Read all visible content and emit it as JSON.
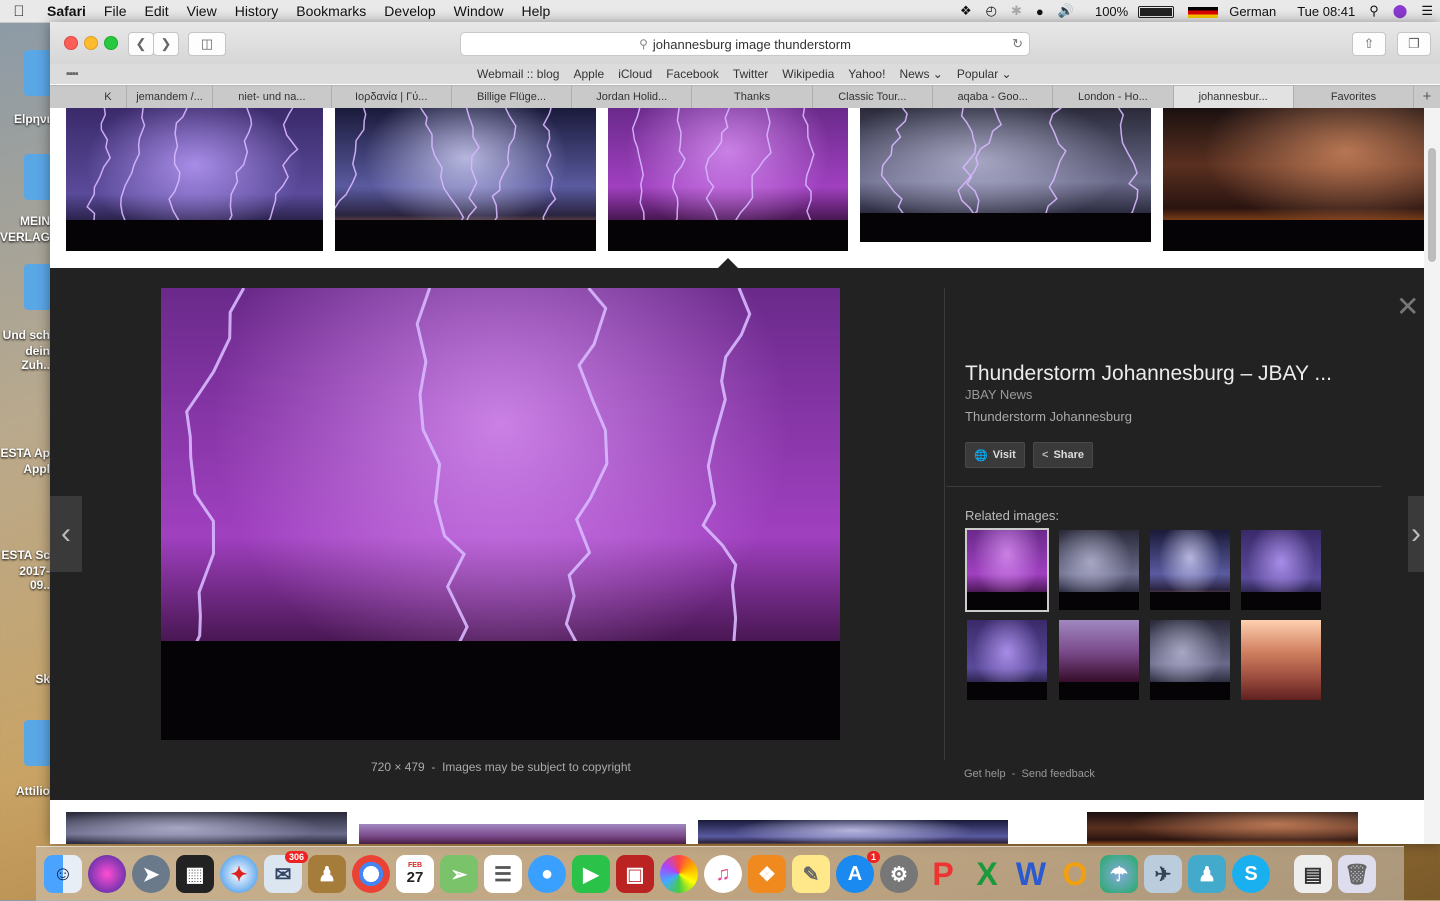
{
  "menubar": {
    "app": "Safari",
    "items": [
      "File",
      "Edit",
      "View",
      "History",
      "Bookmarks",
      "Develop",
      "Window",
      "Help"
    ],
    "battery": "100%",
    "input_source": "German",
    "clock": "Tue 08:41"
  },
  "desktop": {
    "labels": [
      "Elpηνι",
      "MEIN",
      "VERLAG..",
      "Und sch",
      "dein Zuh..",
      "ESTA Ap",
      "Appl",
      "ESTA Sc",
      "2017-09..",
      "Sk",
      "Attilio"
    ]
  },
  "browser": {
    "url": "johannesburg image thunderstorm",
    "favorites": [
      "Webmail :: blog",
      "Apple",
      "iCloud",
      "Facebook",
      "Twitter",
      "Wikipedia",
      "Yahoo!",
      "News ⌄",
      "Popular ⌄"
    ],
    "tabs": [
      "K",
      "jemandem /...",
      "niet- und na...",
      "Ιορδανία | Γύ...",
      "Billige Flüge...",
      "Jordan Holid...",
      "Thanks",
      "Classic Tour...",
      "aqaba - Goo...",
      "London - Ho...",
      "johannesbur...",
      "Favorites"
    ]
  },
  "preview": {
    "title": "Thunderstorm Johannesburg – JBAY ...",
    "source": "JBAY News",
    "description": "Thunderstorm Johannesburg",
    "visit_label": "Visit",
    "share_label": "Share",
    "related_label": "Related images:",
    "dimensions": "720 × 479",
    "copyright": "Images may be subject to copyright",
    "help_label": "Get help",
    "feedback_label": "Send feedback"
  },
  "dock": {
    "mail_badge": "306",
    "appstore_badge": "1",
    "calendar_day": "27",
    "calendar_month": "FEB"
  },
  "colors": {
    "preview_bg": "#222222",
    "lightning": "#d8b8ff"
  }
}
